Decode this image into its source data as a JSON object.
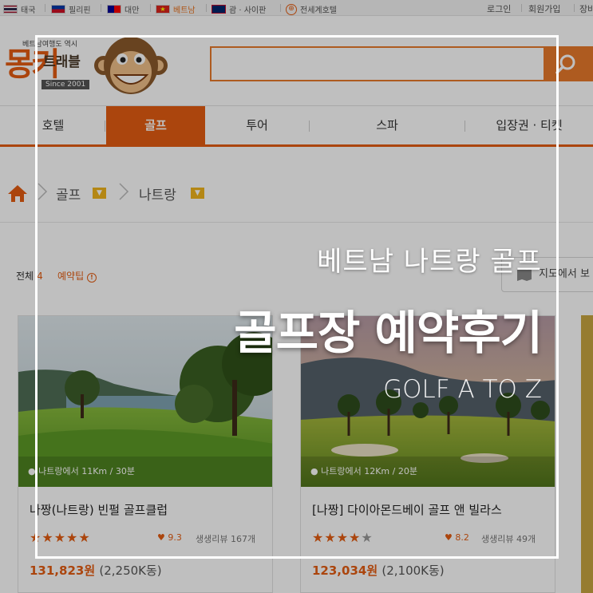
{
  "colors": {
    "accent": "#e45d12",
    "search": "#e97a2b",
    "badge": "#f1b51c"
  },
  "topbar": {
    "languages": [
      {
        "label": "태국",
        "flag": "thailand-flag-icon"
      },
      {
        "label": "필리핀",
        "flag": "philippines-flag-icon"
      },
      {
        "label": "대만",
        "flag": "taiwan-flag-icon"
      },
      {
        "label": "베트남",
        "flag": "vietnam-flag-icon"
      },
      {
        "label": "괌 · 사이판",
        "flag": "guam-flag-icon"
      },
      {
        "label": "전세계호텔",
        "flag": "globe-icon"
      }
    ],
    "login": "로그인",
    "signup": "회원가입",
    "cart": "장바"
  },
  "logo": {
    "subtitle": "베트남여행도 역시",
    "brand": "몽키",
    "brand_travel": "트래블",
    "since": "Since 2001"
  },
  "search": {
    "placeholder": ""
  },
  "nav": [
    "호텔",
    "골프",
    "투어",
    "스파",
    "입장권 · 티켓"
  ],
  "breadcrumb": {
    "level1": "골프",
    "level2": "나트랑"
  },
  "list": {
    "total_label": "전체",
    "total_count": "4",
    "tip_label": "예약팁",
    "map_button": "지도에서 보"
  },
  "cards": [
    {
      "distance": "나트랑에서 11Km / 30분",
      "name": "나짱(나트랑) 빈펄 골프클럽",
      "stars": 5,
      "score": "9.3",
      "review_label": "생생리뷰",
      "review_count": "167개",
      "price": "131,823원",
      "price_krw": "(2,250K동)"
    },
    {
      "distance": "나트랑에서 12Km / 20분",
      "name": "[나짱] 다이아몬드베이 골프 앤 빌라스",
      "stars": 4,
      "score": "8.2",
      "review_label": "생생리뷰",
      "review_count": "49개",
      "price": "123,034원",
      "price_krw": "(2,100K동)"
    }
  ],
  "overlay": {
    "subtitle": "베트남 나트랑 골프",
    "title": "골프장 예약후기",
    "english": "GOLF A TO Z"
  }
}
